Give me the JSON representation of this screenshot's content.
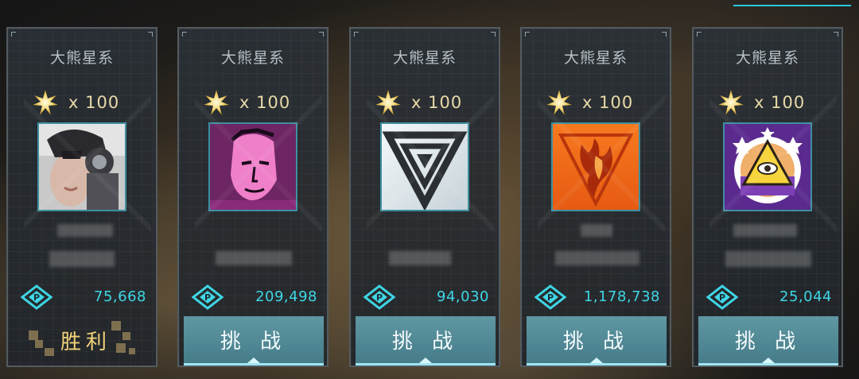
{
  "colors": {
    "accent": "#3fd6e6",
    "victory": "#f2d27a",
    "button": "#5f97a3",
    "reward_text": "#e7d9a8"
  },
  "cards": [
    {
      "title": "大熊星系",
      "reward_icon": "star-burst-icon",
      "reward_text": "x 100",
      "avatar": "cyborg-woman-portrait",
      "currency_icon": "p-points-icon",
      "score": "75,668",
      "action_label": "胜利",
      "status": "victory"
    },
    {
      "title": "大熊星系",
      "reward_icon": "star-burst-icon",
      "reward_text": "x 100",
      "avatar": "pink-cyber-face",
      "currency_icon": "p-points-icon",
      "score": "209,498",
      "action_label": "挑 战",
      "status": "challenge"
    },
    {
      "title": "大熊星系",
      "reward_icon": "star-burst-icon",
      "reward_text": "x 100",
      "avatar": "triangle-emblem",
      "currency_icon": "p-points-icon",
      "score": "94,030",
      "action_label": "挑 战",
      "status": "challenge"
    },
    {
      "title": "大熊星系",
      "reward_icon": "star-burst-icon",
      "reward_text": "x 100",
      "avatar": "flame-emblem",
      "currency_icon": "p-points-icon",
      "score": "1,178,738",
      "action_label": "挑 战",
      "status": "challenge"
    },
    {
      "title": "大熊星系",
      "reward_icon": "star-burst-icon",
      "reward_text": "x 100",
      "avatar": "eye-pyramid-emblem",
      "currency_icon": "p-points-icon",
      "score": "25,044",
      "action_label": "挑 战",
      "status": "challenge"
    }
  ]
}
